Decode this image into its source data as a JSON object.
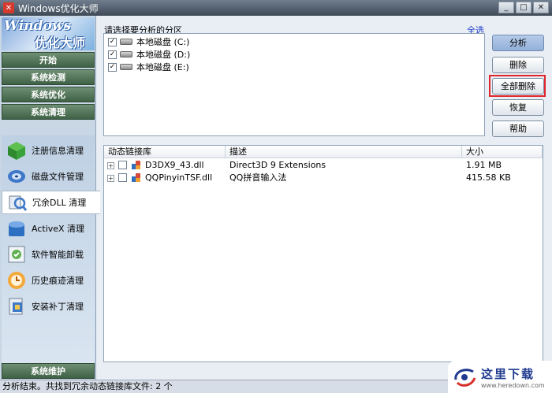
{
  "window": {
    "title": "Windows优化大师",
    "min": "_",
    "max": "□",
    "close": "✕"
  },
  "logo": {
    "line1": "Windows",
    "line2": "优化大师"
  },
  "nav": {
    "start": "开始",
    "detect": "系统检测",
    "optimize": "系统优化",
    "clean": "系统清理",
    "maintain": "系统维护"
  },
  "subnav": [
    {
      "label": "注册信息清理",
      "icon": "registry-cube-icon"
    },
    {
      "label": "磁盘文件管理",
      "icon": "disk-icon"
    },
    {
      "label": "冗余DLL 清理",
      "icon": "dll-search-icon"
    },
    {
      "label": "ActiveX 清理",
      "icon": "activex-icon"
    },
    {
      "label": "软件智能卸载",
      "icon": "uninstall-icon"
    },
    {
      "label": "历史痕迹清理",
      "icon": "history-icon"
    },
    {
      "label": "安装补丁清理",
      "icon": "patch-icon"
    }
  ],
  "partition": {
    "label": "请选择要分析的分区",
    "select_all": "全选",
    "drives": [
      {
        "label": "本地磁盘 (C:)",
        "checked": "✓"
      },
      {
        "label": "本地磁盘 (D:)",
        "checked": "✓"
      },
      {
        "label": "本地磁盘 (E:)",
        "checked": "✓"
      }
    ]
  },
  "buttons": {
    "analyze": "分析",
    "delete": "删除",
    "delete_all": "全部删除",
    "restore": "恢复",
    "help": "帮助"
  },
  "list": {
    "columns": [
      "动态链接库",
      "描述",
      "大小"
    ],
    "rows": [
      {
        "name": "D3DX9_43.dll",
        "desc": "Direct3D 9 Extensions",
        "size": "1.91 MB"
      },
      {
        "name": "QQPinyinTSF.dll",
        "desc": "QQ拼音输入法",
        "size": "415.58 KB"
      }
    ]
  },
  "status": "分析结束。共找到冗余动态链接库文件: 2 个",
  "watermark": {
    "text": "这里下载",
    "url": "www.heredown.com"
  },
  "colors": {
    "accent_red": "#e0262c",
    "link_blue": "#1f3ec9",
    "nav_green": "#3f6146"
  }
}
